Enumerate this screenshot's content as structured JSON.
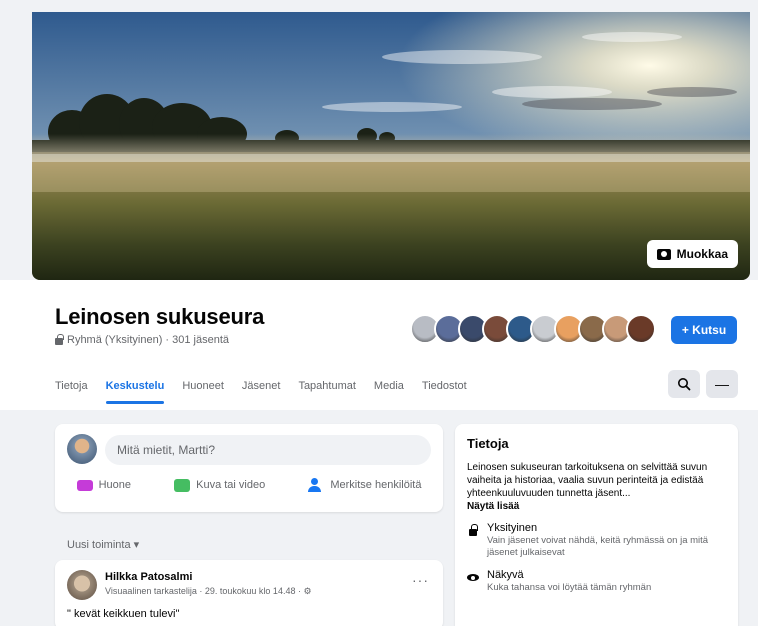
{
  "cover": {
    "edit_label": "Muokkaa"
  },
  "group": {
    "name": "Leinosen sukuseura",
    "subtitle": "Ryhmä (Yksityinen) · 301 jäsentä",
    "invite_label": "+ Kutsu",
    "member_avatar_colors": [
      "#b8bcc4",
      "#5b6d9a",
      "#3a4a6b",
      "#7a4b3a",
      "#2d5a8a",
      "#c9ccd1",
      "#e8a060",
      "#8a6a4a",
      "#c89a78",
      "#6a3a28"
    ]
  },
  "tabs": [
    "Tietoja",
    "Keskustelu",
    "Huoneet",
    "Jäsenet",
    "Tapahtumat",
    "Media",
    "Tiedostot"
  ],
  "active_tab": "Keskustelu",
  "composer": {
    "placeholder": "Mitä mietit, Martti?",
    "actions": [
      "Huone",
      "Kuva tai video",
      "Merkitse henkilöitä"
    ]
  },
  "feed": {
    "sort_label": "Uusi toiminta ▾"
  },
  "post": {
    "author": "Hilkka Patosalmi",
    "meta": "Visuaalinen tarkastelija · 29. toukokuu klo 14.48 · ⚙",
    "text": "\" kevät keikkuen tulevi\"",
    "more": "···"
  },
  "about": {
    "title": "Tietoja",
    "description": "Leinosen sukuseuran tarkoituksena on selvittää suvun vaiheita ja historiaa, vaalia suvun perinteitä ja edistää yhteenkuuluvuuden tunnetta jäsent...",
    "more_label": "Näytä lisää",
    "rows": [
      {
        "icon": "lock-icon",
        "title": "Yksityinen",
        "text": "Vain jäsenet voivat nähdä, keitä ryhmässä on ja mitä jäsenet julkaisevat"
      },
      {
        "icon": "eye-icon",
        "title": "Näkyvä",
        "text": "Kuka tahansa voi löytää tämän ryhmän"
      }
    ]
  },
  "colors": {
    "accent": "#1b74e4",
    "background": "#f0f2f5"
  }
}
